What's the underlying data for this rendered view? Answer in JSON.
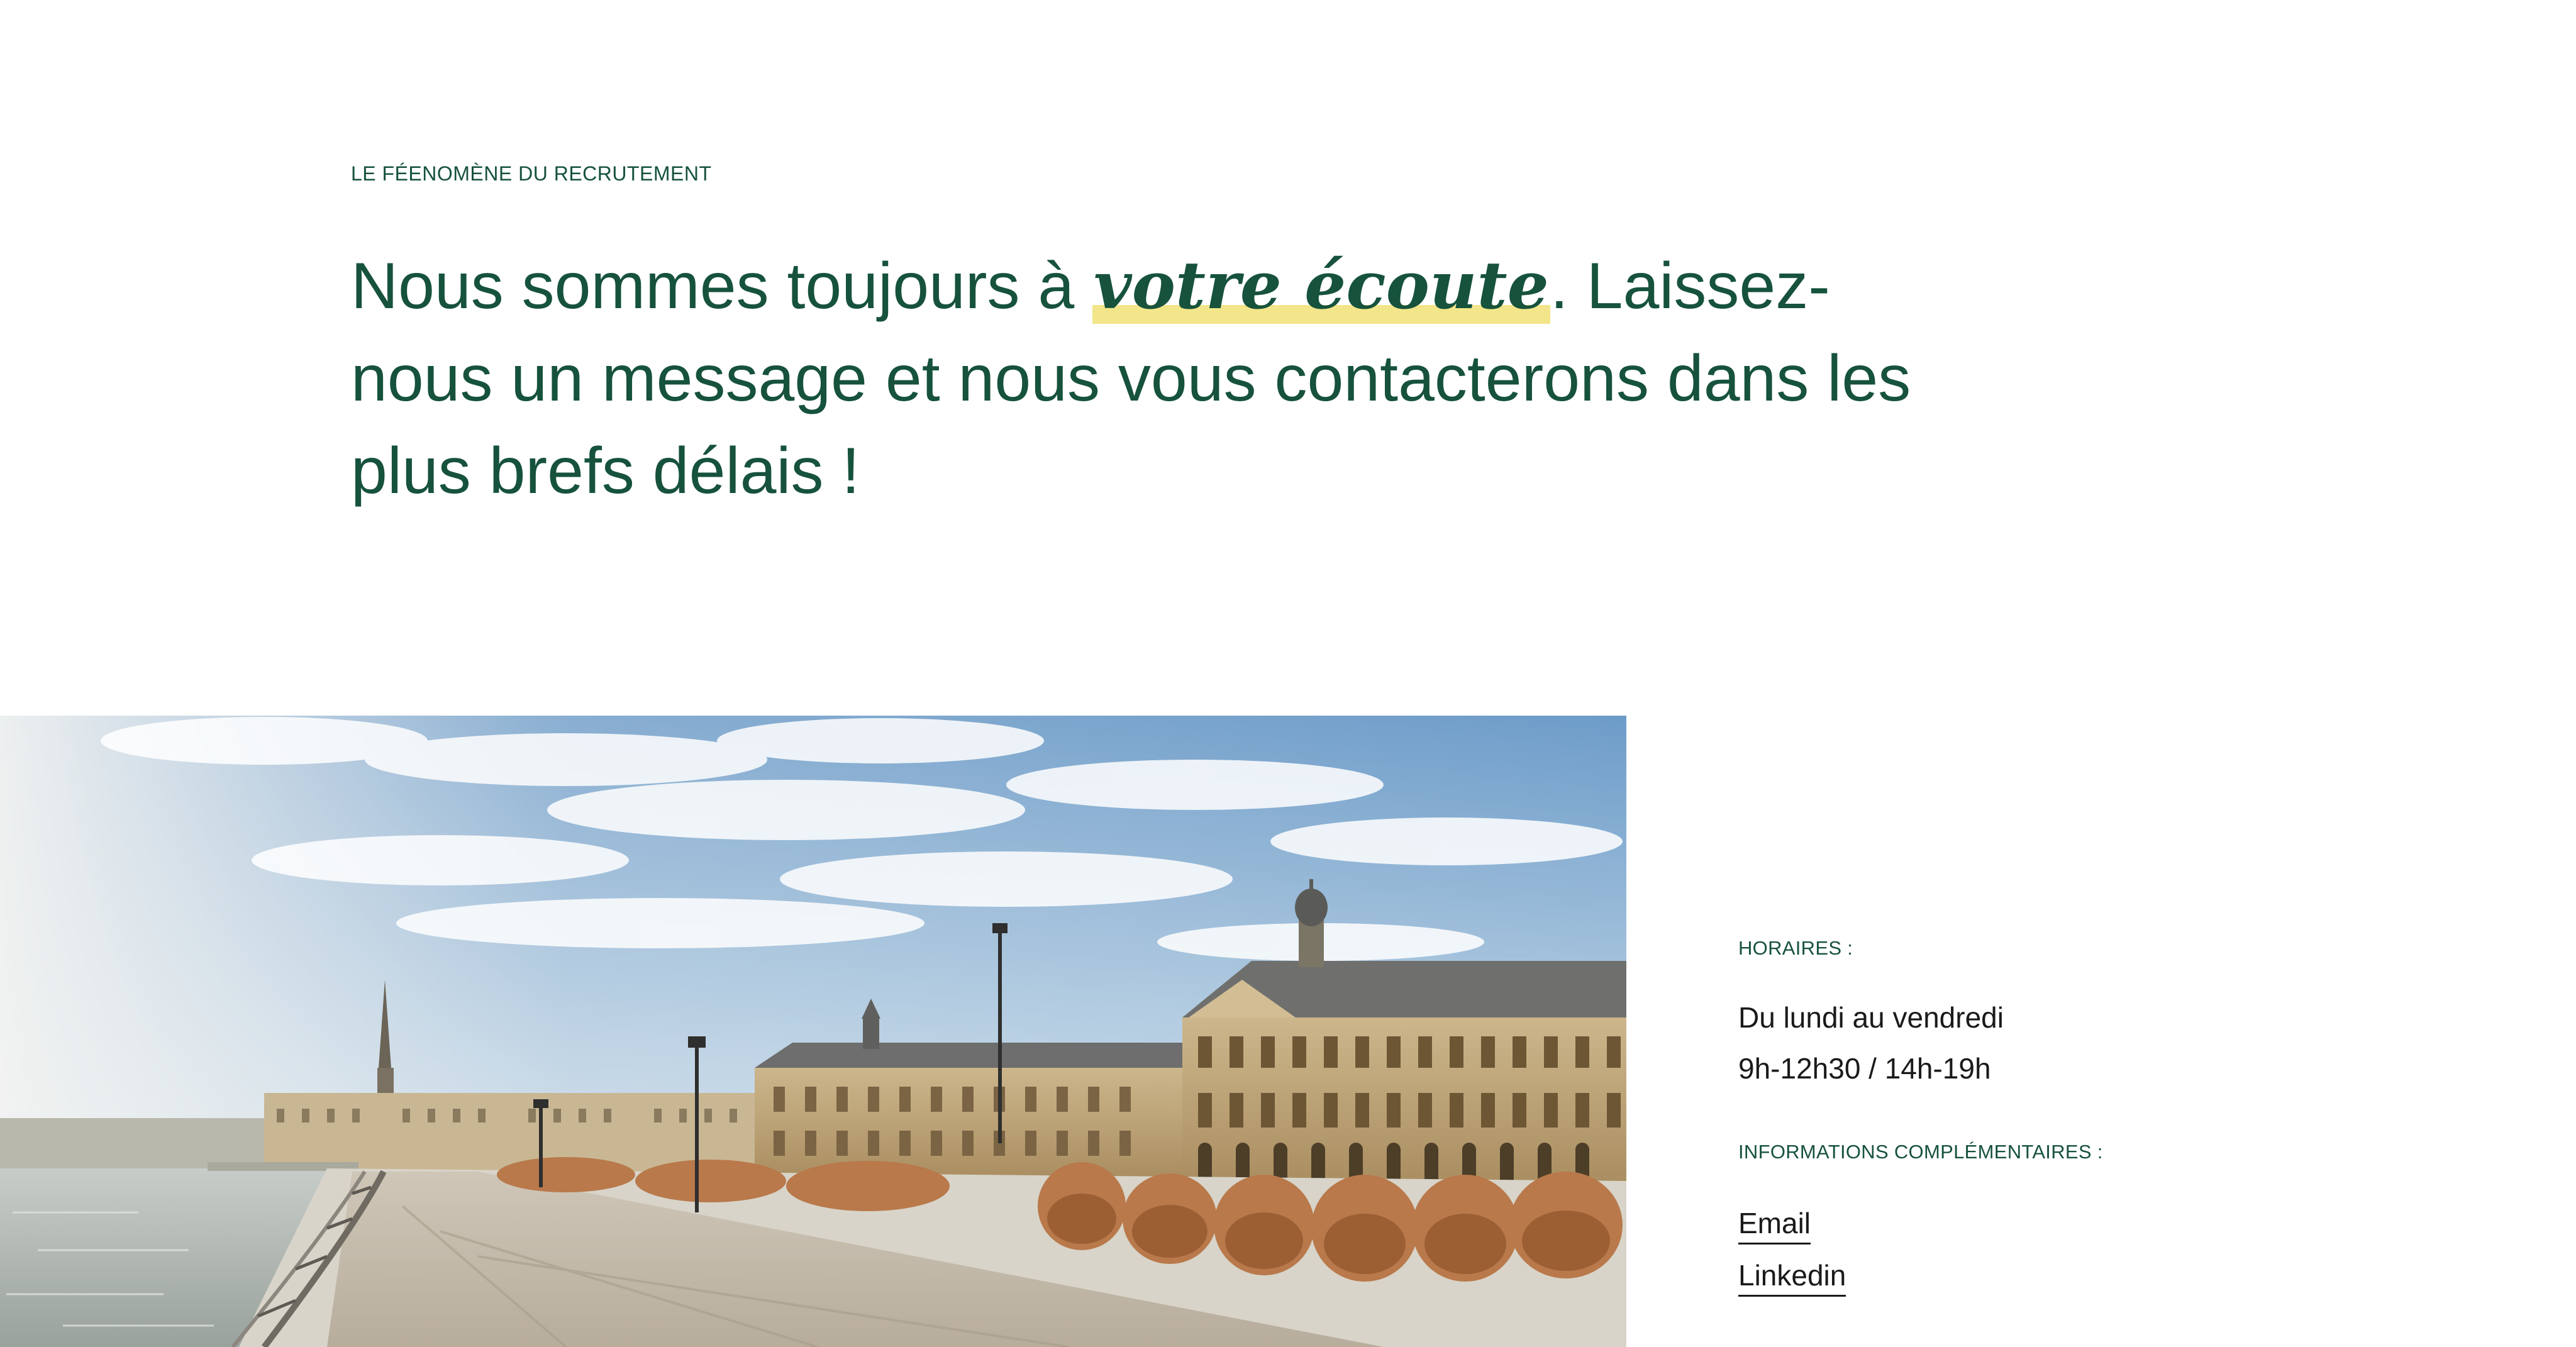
{
  "section": {
    "eyebrow": "LE FÉENOMÈNE DU RECRUTEMENT",
    "headline_before": "Nous sommes toujours à ",
    "headline_highlight": "votre écoute",
    "headline_after": ". Laissez-nous un message et nous vous contacterons dans les plus brefs délais !"
  },
  "hero_image": {
    "alt": "Place de la Bourse, Bordeaux"
  },
  "info": {
    "hours_label": "HORAIRES :",
    "hours_days": "Du lundi au vendredi",
    "hours_times": "9h-12h30 / 14h-19h",
    "extra_label": "INFORMATIONS COMPLÉMENTAIRES :",
    "links": [
      "Email",
      "Linkedin"
    ]
  },
  "colors": {
    "brand_green": "#16523c",
    "highlight_yellow": "#f2e58a"
  }
}
